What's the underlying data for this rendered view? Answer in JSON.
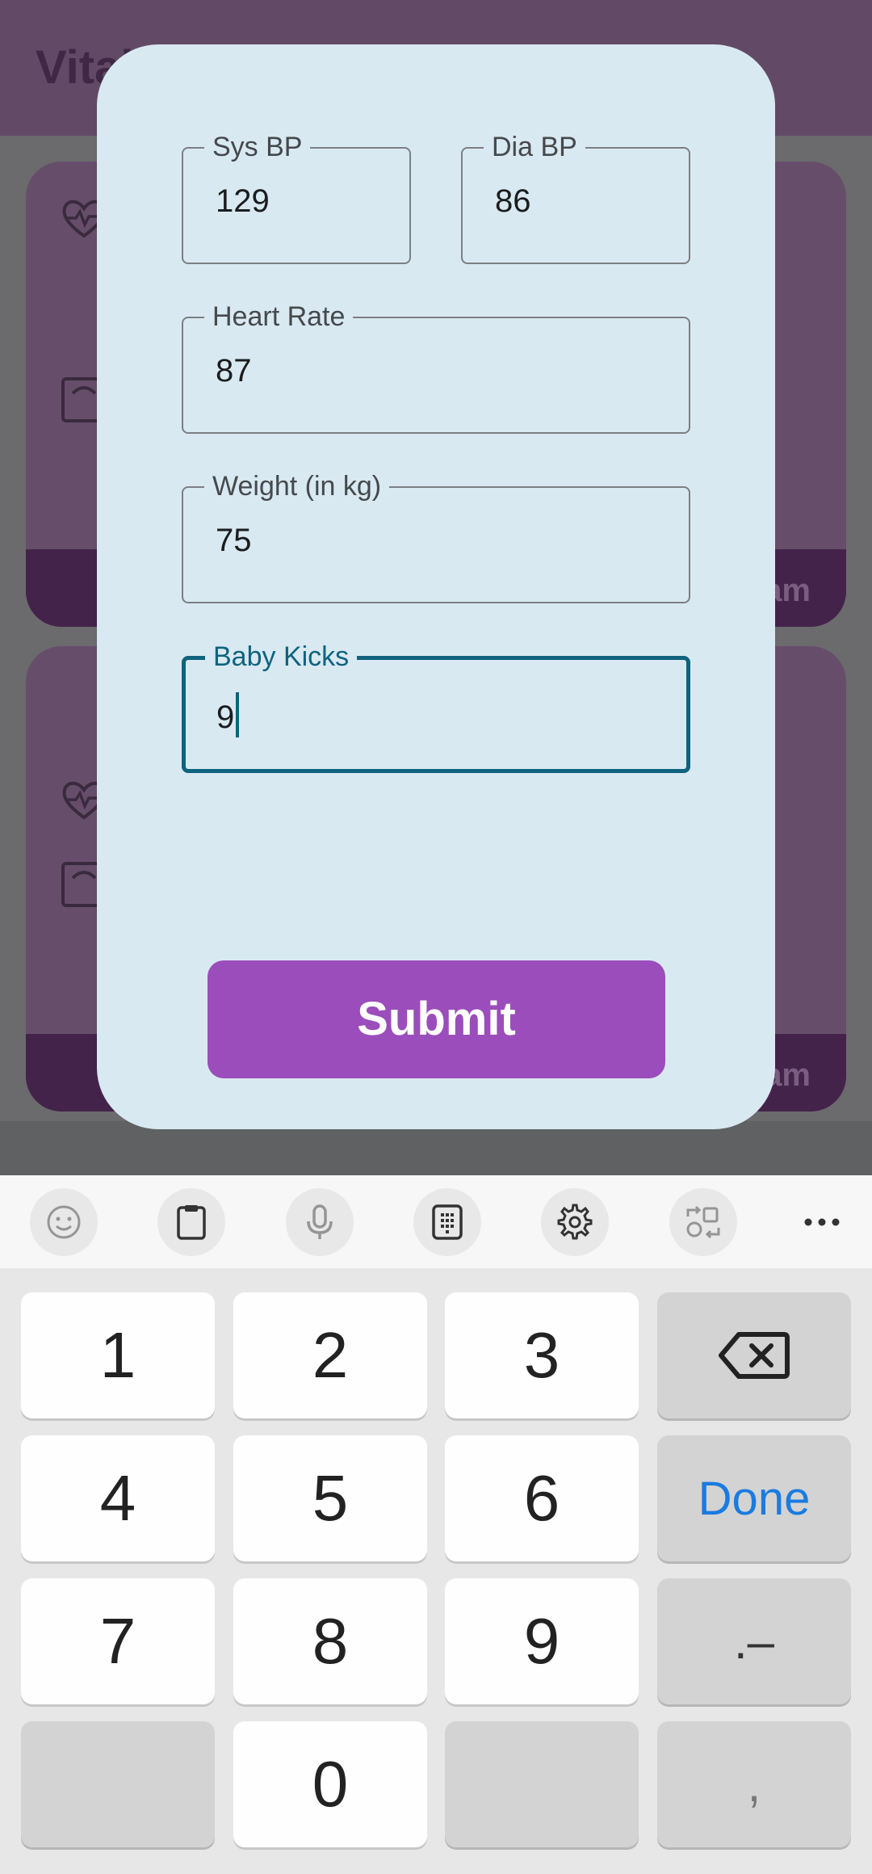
{
  "background_app": {
    "title": "Vital",
    "card_time_suffix": "am"
  },
  "form": {
    "sys_bp": {
      "label": "Sys BP",
      "value": "129"
    },
    "dia_bp": {
      "label": "Dia BP",
      "value": "86"
    },
    "heart_rate": {
      "label": "Heart Rate",
      "value": "87"
    },
    "weight": {
      "label": "Weight (in kg)",
      "value": "75"
    },
    "baby_kicks": {
      "label": "Baby Kicks",
      "value": "9"
    },
    "submit_label": "Submit"
  },
  "keyboard": {
    "toolbar_icons": [
      "emoji-icon",
      "clipboard-icon",
      "mic-icon",
      "keyboard-layout-icon",
      "settings-icon",
      "translate-icon",
      "more-icon"
    ],
    "keys": {
      "k1": "1",
      "k2": "2",
      "k3": "3",
      "k4": "4",
      "k5": "5",
      "k6": "6",
      "k7": "7",
      "k8": "8",
      "k9": "9",
      "k0": "0",
      "done": "Done",
      "dot_dash": ".–",
      "comma": ","
    }
  },
  "colors": {
    "dialog_bg": "#d9e9f1",
    "submit_bg": "#9b4dbb",
    "focus_accent": "#0f637e",
    "done_blue": "#1a7be0"
  }
}
